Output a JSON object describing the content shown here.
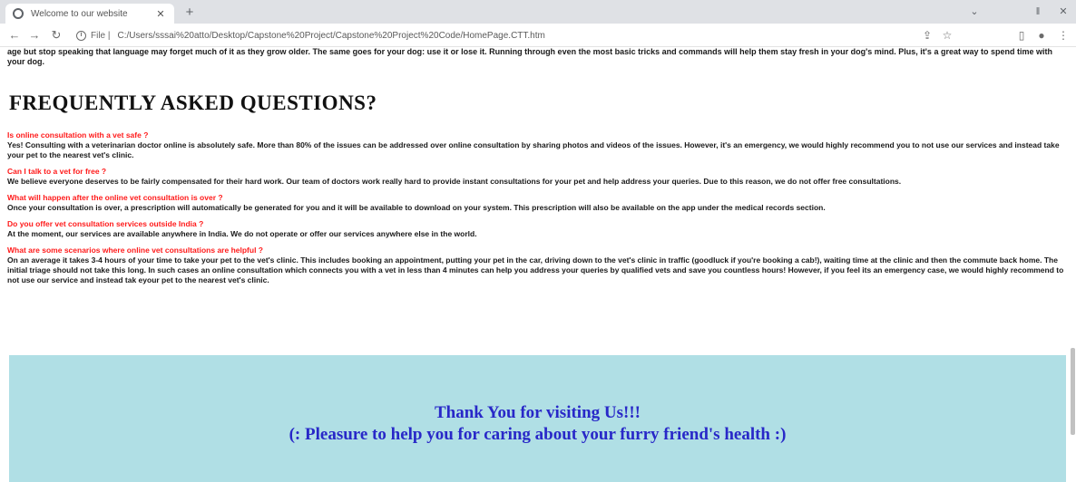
{
  "browser": {
    "tab": {
      "title": "Welcome to our website",
      "close_icon": "close-icon"
    },
    "new_tab_label": "+",
    "window_controls": [
      "chevron-down-icon",
      "minimize-icon",
      "close-icon"
    ],
    "nav": {
      "back": "back-arrow-icon",
      "forward": "forward-arrow-icon",
      "reload": "reload-icon"
    },
    "address_bar": {
      "scheme": "File |",
      "url": "C:/Users/sssai%20atto/Desktop/Capstone%20Project/Capstone%20Project%20Code/HomePage.CTT.htm"
    },
    "toolbar_icons": [
      "share-icon",
      "star-icon",
      "sidepanel-icon",
      "profile-icon",
      "menu-icon"
    ]
  },
  "page": {
    "intro": "age but stop speaking that language may forget much of it as they grow older. The same goes for your dog: use it or lose it. Running through even the most basic tricks and commands will help them stay fresh in your dog's mind. Plus, it's a great way to spend time with your dog.",
    "faq_heading": "FREQUENTLY ASKED QUESTIONS?",
    "faqs": [
      {
        "question": "Is online consultation with a vet safe ?",
        "answer": "Yes! Consulting with a veterinarian doctor online is absolutely safe. More than 80% of the issues can be addressed over online consultation by sharing photos and videos of the issues. However, it's an emergency, we would highly recommend you to not use our services and instead take your pet to the nearest vet's clinic."
      },
      {
        "question": "Can I talk to a vet for free ?",
        "answer": "We believe everyone deserves to be fairly compensated for their hard work. Our team of doctors work really hard to provide instant consultations for your pet and help address your queries. Due to this reason, we do not offer free consultations."
      },
      {
        "question": "What will happen after the online vet consultation is over ?",
        "answer": "Once your consultation is over, a prescription will automatically be generated for you and it will be available to download on your system. This prescription will also be available on the app under the medical records section."
      },
      {
        "question": "Do you offer vet consultation services outside India ?",
        "answer": "At the moment, our services are available anywhere in India. We do not operate or offer our services anywhere else in the world."
      },
      {
        "question": "What are some scenarios where online vet consultations are helpful ?",
        "answer": "On an average it takes 3-4 hours of your time to take your pet to the vet's clinic. This includes booking an appointment, putting your pet in the car, driving down to the vet's clinic in traffic (goodluck if you're booking a cab!), waiting time at the clinic and then the commute back home. The initial triage should not take this long. In such cases an online consultation which connects you with a vet in less than 4 minutes can help you address your queries by qualified vets and save you countless hours! However, if you feel its an emergency case, we would highly recommend to not use our service and instead tak eyour pet to the nearest vet's clinic."
      }
    ],
    "thanks_line1": "Thank You for visiting Us!!!",
    "thanks_line2": "(: Pleasure to help you for caring about your furry friend's health :)"
  },
  "colors": {
    "question_red": "#ff1a1a",
    "thanks_bg": "#b0dfe5",
    "thanks_text": "#2828c8"
  }
}
